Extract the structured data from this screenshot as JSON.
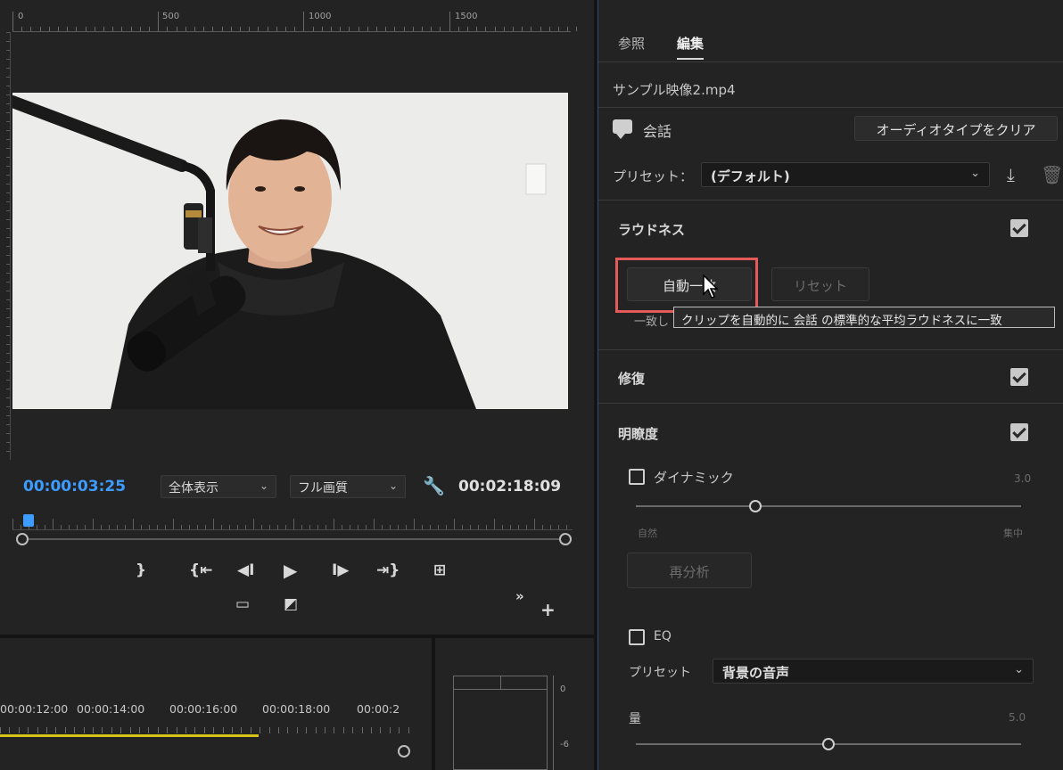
{
  "monitor": {
    "ruler_labels": [
      "0",
      "500",
      "1000",
      "1500"
    ],
    "timecode_current": "00:00:03:25",
    "zoom_select": "全体表示",
    "quality_select": "フル画質",
    "timecode_duration": "00:02:18:09",
    "controls": {
      "mark_out": "}",
      "go_to_in": "{⇤",
      "step_back": "◀I",
      "play": "▶",
      "step_forward": "I▶",
      "go_to_out": "⇥}",
      "insert": "⊞",
      "safe_margins": "▭",
      "export_frame": "◩",
      "more": "»",
      "add": "+"
    }
  },
  "timeline": {
    "timecodes": [
      "00:00:12:00",
      "00:00:14:00",
      "00:00:16:00",
      "00:00:18:00",
      "00:00:2"
    ]
  },
  "meter": {
    "scale_labels": [
      "0",
      "-6"
    ]
  },
  "panel": {
    "tabs": [
      "参照",
      "編集"
    ],
    "active_tab": "編集",
    "file_name": "サンプル映像2.mp4",
    "audio_type": "会話",
    "clear_button": "オーディオタイプをクリア",
    "preset_label": "プリセット：",
    "preset_value": "(デフォルト)",
    "loudness": {
      "title": "ラウドネス",
      "auto_match": "自動一致",
      "reset": "リセット",
      "match_label_partial": "一致し",
      "tooltip": "クリップを自動的に 会話 の標準的な平均ラウドネスに一致"
    },
    "repair": {
      "title": "修復"
    },
    "clarity": {
      "title": "明瞭度",
      "dynamics_label": "ダイナミック",
      "dynamics_value": "3.0",
      "dynamics_min": "自然",
      "dynamics_max": "集中",
      "dynamics_level": 0.31,
      "reanalyze": "再分析",
      "eq_label": "EQ",
      "eq_preset_label": "プリセット",
      "eq_preset_value": "背景の音声",
      "amount_label": "量",
      "amount_value": "5.0",
      "amount_level": 0.5
    }
  }
}
